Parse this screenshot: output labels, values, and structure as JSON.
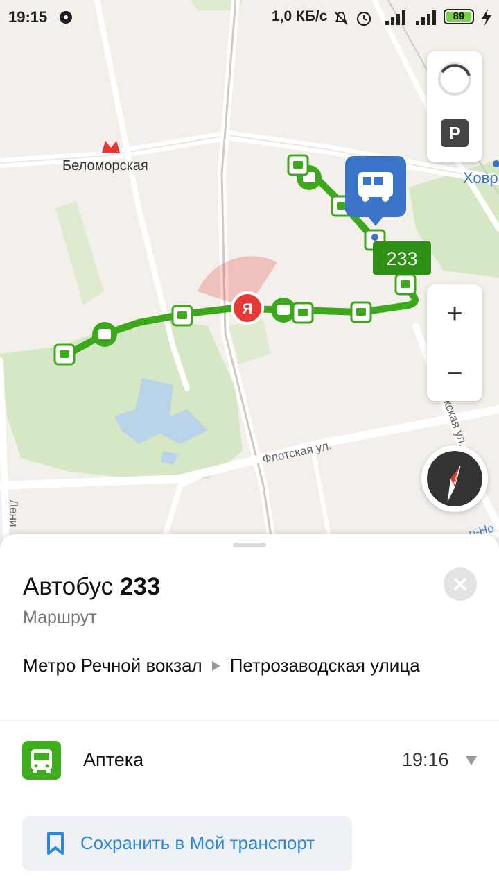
{
  "status_bar": {
    "time": "19:15",
    "network_speed": "1,0 КБ/с",
    "battery_level": "89",
    "battery_percent": 89
  },
  "map": {
    "metro_station": "Беломорская",
    "district_label": "Ховр",
    "street_flotskaya": "Флотская ул.",
    "street_onezhskaya": "Онежская ул.",
    "street_leningradskoe": "Лени",
    "street_bottom_right": "р-Но",
    "route_badge": "233",
    "user_marker": "Я",
    "parking_label": "P",
    "zoom_in_label": "+",
    "zoom_out_label": "−",
    "colors": {
      "route": "#3da81c",
      "selected_stop": "#3b73c9",
      "user_marker": "#e53935",
      "park": "#d8e8c8",
      "water": "#b9d3e9"
    }
  },
  "sheet": {
    "title_prefix": "Автобус",
    "title_number": "233",
    "subtitle": "Маршрут",
    "route_from": "Метро Речной вокзал",
    "route_to": "Петрозаводская улица",
    "stop_icon": "bus-icon",
    "stop_name": "Аптека",
    "stop_time": "19:16",
    "save_label": "Сохранить в Мой транспорт",
    "save_icon": "bookmark-icon"
  }
}
